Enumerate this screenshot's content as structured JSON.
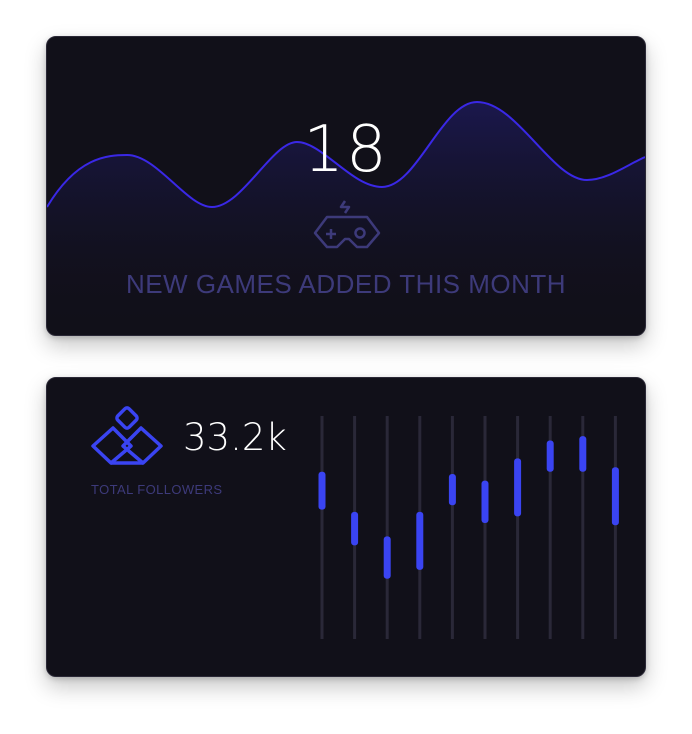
{
  "games_card": {
    "value": "18",
    "label": "NEW GAMES ADDED THIS MONTH",
    "icon": "gamepad-icon",
    "colors": {
      "wave_line": "#3a28e6",
      "wave_fill": "#1b1850",
      "caption": "#3d3a7a",
      "card_bg": "#111019"
    }
  },
  "followers_card": {
    "value": "33.2k",
    "label": "TOTAL FOLLOWERS",
    "icon": "diamond-logo-icon",
    "colors": {
      "accent": "#3a44f2",
      "track": "#2a2838",
      "caption": "#3d3a7a"
    }
  },
  "chart_data": {
    "type": "candlestick-bars",
    "series": [
      {
        "values": [
          {
            "low": 0.58,
            "high": 0.75
          },
          {
            "low": 0.42,
            "high": 0.57
          },
          {
            "low": 0.27,
            "high": 0.46
          },
          {
            "low": 0.31,
            "high": 0.57
          },
          {
            "low": 0.6,
            "high": 0.74
          },
          {
            "low": 0.52,
            "high": 0.71
          },
          {
            "low": 0.55,
            "high": 0.81
          },
          {
            "low": 0.75,
            "high": 0.89
          },
          {
            "low": 0.75,
            "high": 0.91
          },
          {
            "low": 0.51,
            "high": 0.77
          }
        ]
      }
    ],
    "ylim": [
      0,
      1
    ]
  }
}
